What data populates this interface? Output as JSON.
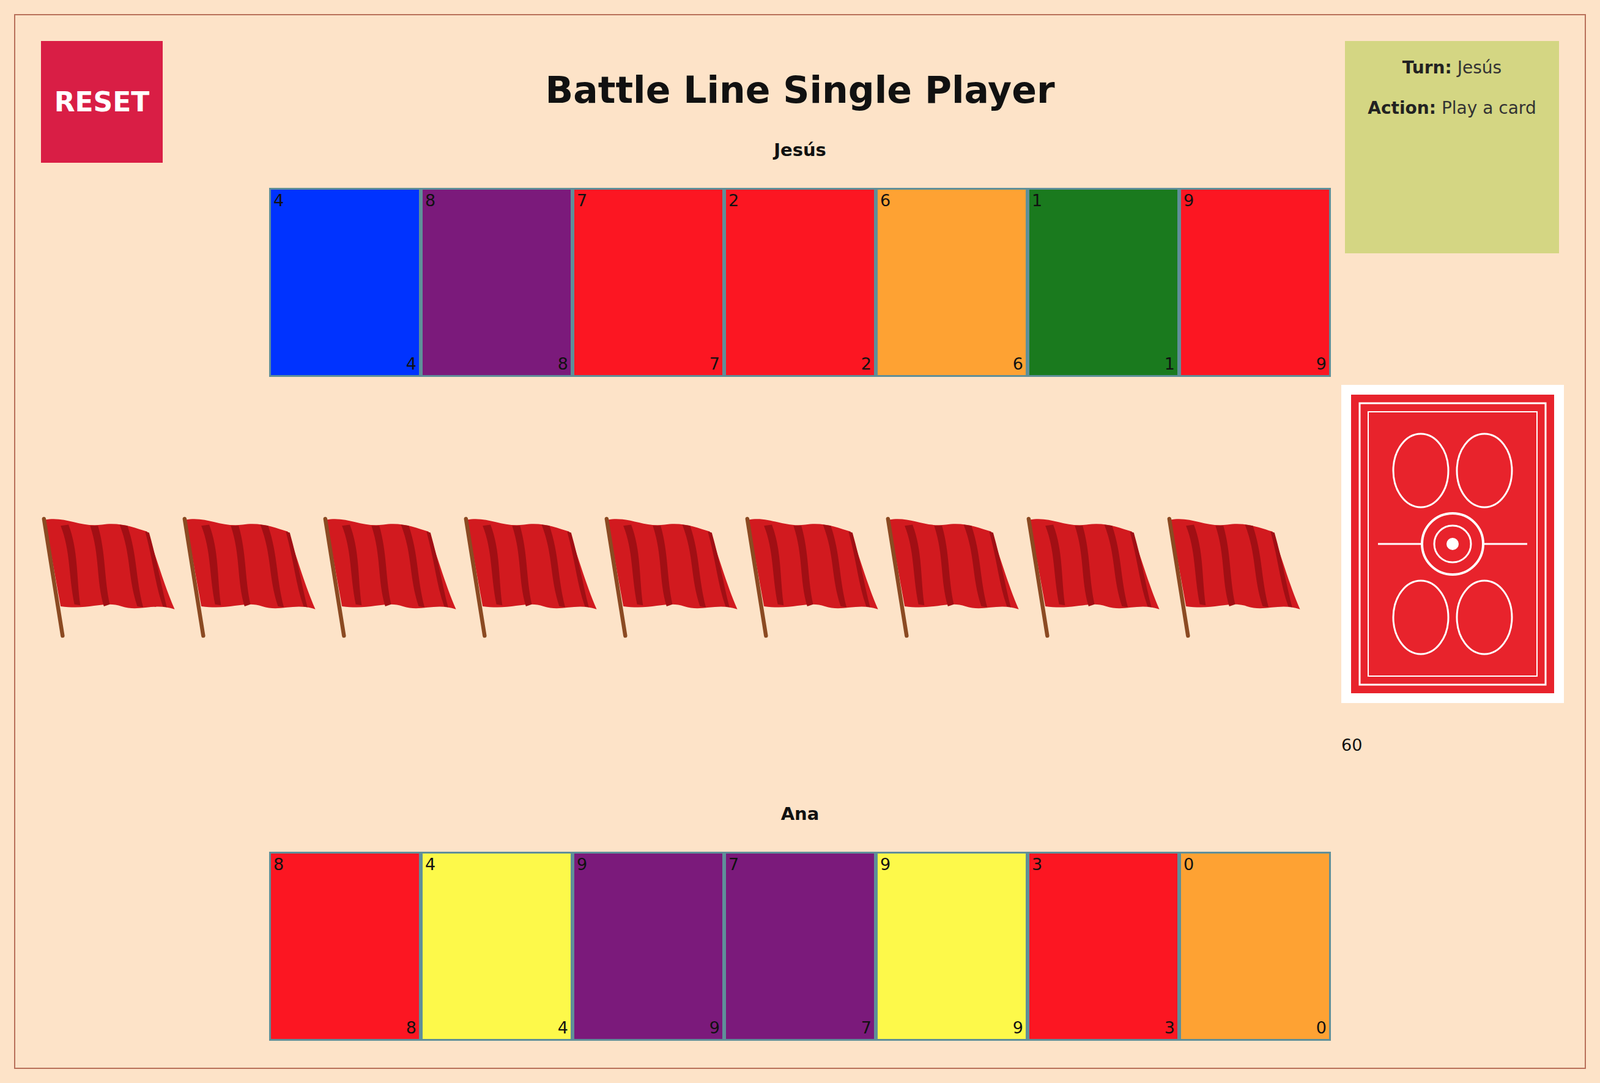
{
  "title": "Battle Line Single Player",
  "reset": "RESET",
  "status": {
    "turn_label": "Turn:",
    "turn": "Jesús",
    "action_label": "Action:",
    "action": "Play a card"
  },
  "players": [
    {
      "name": "Jesús",
      "hand": [
        {
          "value": "4",
          "color": "#0033ff"
        },
        {
          "value": "8",
          "color": "#7b1a7b"
        },
        {
          "value": "7",
          "color": "#fc1622"
        },
        {
          "value": "2",
          "color": "#fc1622"
        },
        {
          "value": "6",
          "color": "#fea233"
        },
        {
          "value": "1",
          "color": "#1a7a1e"
        },
        {
          "value": "9",
          "color": "#fc1622"
        }
      ]
    },
    {
      "name": "Ana",
      "hand": [
        {
          "value": "8",
          "color": "#fc1622"
        },
        {
          "value": "4",
          "color": "#fdf94a"
        },
        {
          "value": "9",
          "color": "#7b1a7b"
        },
        {
          "value": "7",
          "color": "#7b1a7b"
        },
        {
          "value": "9",
          "color": "#fdf94a"
        },
        {
          "value": "3",
          "color": "#fc1622"
        },
        {
          "value": "0",
          "color": "#fea233"
        }
      ]
    }
  ],
  "flags": [
    {
      "claimed": false
    },
    {
      "claimed": false
    },
    {
      "claimed": false
    },
    {
      "claimed": false
    },
    {
      "claimed": false
    },
    {
      "claimed": false
    },
    {
      "claimed": false
    },
    {
      "claimed": false
    },
    {
      "claimed": false
    }
  ],
  "deck": {
    "count": "60"
  }
}
